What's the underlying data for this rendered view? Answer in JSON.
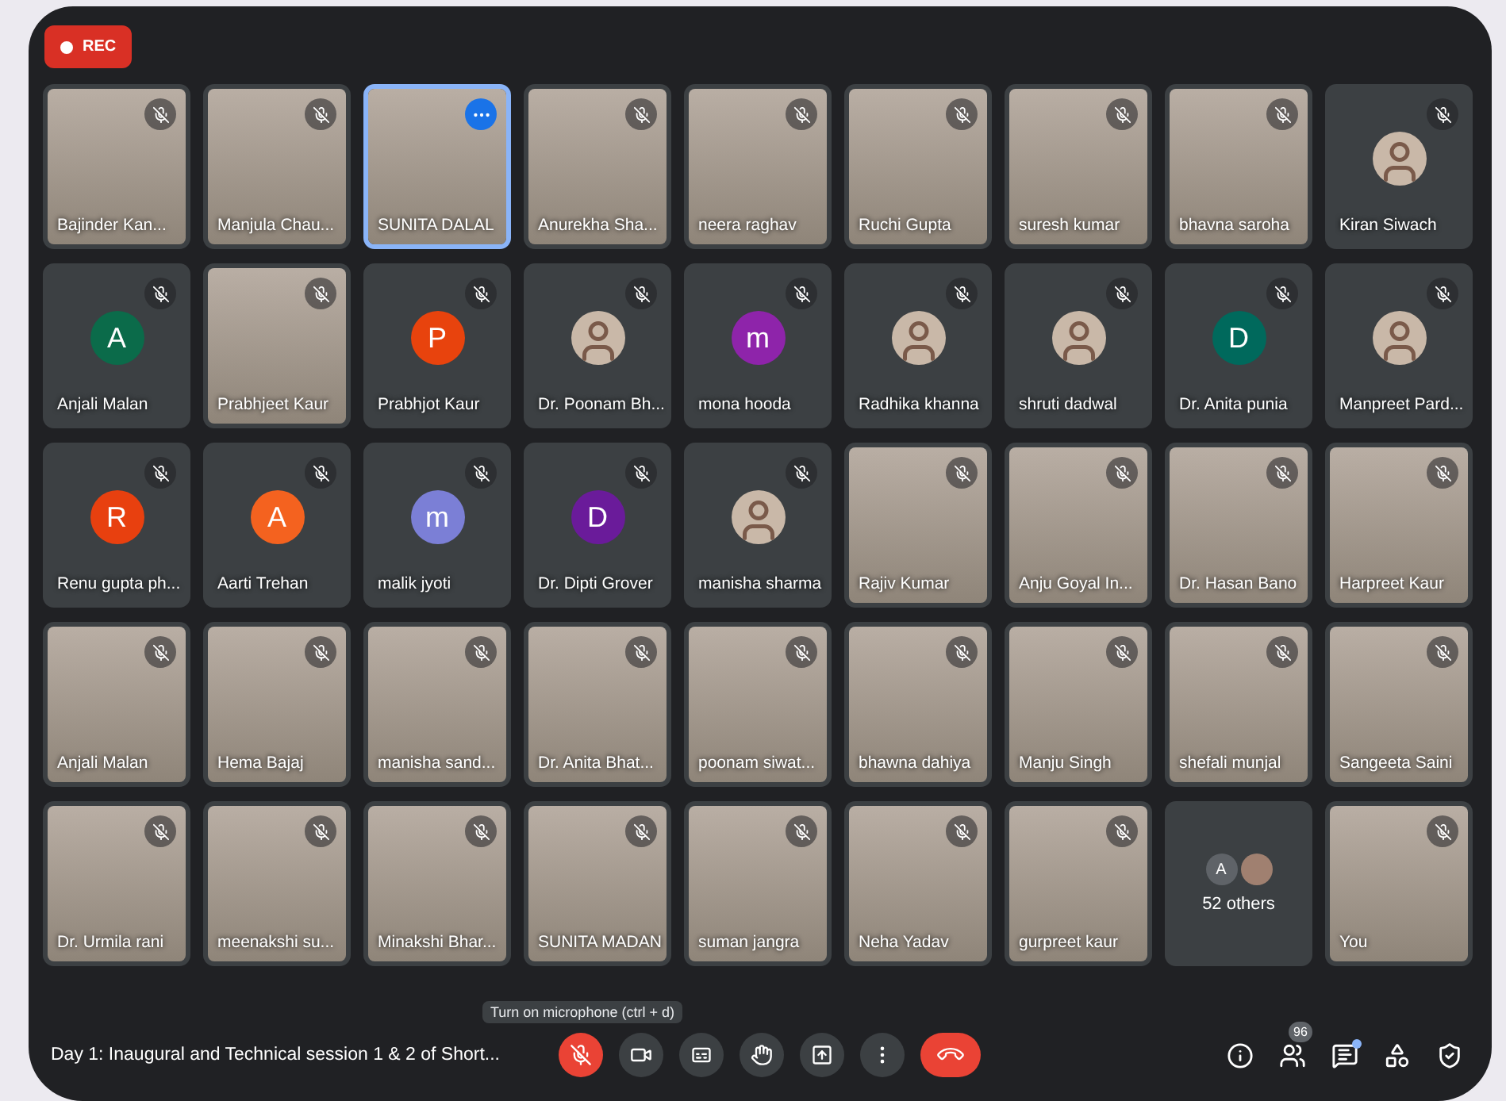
{
  "recording": {
    "label": "REC",
    "active": true
  },
  "tiles": [
    {
      "kind": "video",
      "name": "Bajinder Kan...",
      "muted": true,
      "speaking": false
    },
    {
      "kind": "video",
      "name": "Manjula Chau...",
      "muted": true,
      "speaking": false
    },
    {
      "kind": "video",
      "name": "SUNITA DALAL",
      "muted": false,
      "speaking": true
    },
    {
      "kind": "video",
      "name": "Anurekha Sha...",
      "muted": true,
      "speaking": false
    },
    {
      "kind": "video",
      "name": "neera raghav",
      "muted": true,
      "speaking": false
    },
    {
      "kind": "video",
      "name": "Ruchi Gupta",
      "muted": true,
      "speaking": false
    },
    {
      "kind": "video",
      "name": "suresh kumar",
      "muted": true,
      "speaking": false
    },
    {
      "kind": "video",
      "name": "bhavna saroha",
      "muted": true,
      "speaking": false
    },
    {
      "kind": "photo",
      "name": "Kiran Siwach",
      "muted": true,
      "speaking": false
    },
    {
      "kind": "initial",
      "name": "Anjali Malan",
      "initial": "A",
      "color": "#0b6b4a",
      "muted": true,
      "speaking": false
    },
    {
      "kind": "video",
      "name": "Prabhjeet Kaur",
      "muted": true,
      "speaking": false
    },
    {
      "kind": "initial",
      "name": "Prabhjot Kaur",
      "initial": "P",
      "color": "#e8430d",
      "muted": true,
      "speaking": false
    },
    {
      "kind": "photo",
      "name": "Dr. Poonam Bh...",
      "muted": true,
      "speaking": false
    },
    {
      "kind": "initial",
      "name": "mona hooda",
      "initial": "m",
      "color": "#8e24aa",
      "muted": true,
      "speaking": false
    },
    {
      "kind": "photo",
      "name": "Radhika khanna",
      "muted": true,
      "speaking": false
    },
    {
      "kind": "photo",
      "name": "shruti dadwal",
      "muted": true,
      "speaking": false
    },
    {
      "kind": "initial",
      "name": "Dr. Anita punia",
      "initial": "D",
      "color": "#00695c",
      "muted": true,
      "speaking": false
    },
    {
      "kind": "photo",
      "name": "Manpreet Pard...",
      "muted": true,
      "speaking": false
    },
    {
      "kind": "initial",
      "name": "Renu gupta ph...",
      "initial": "R",
      "color": "#e8400f",
      "muted": true,
      "speaking": false
    },
    {
      "kind": "initial",
      "name": "Aarti Trehan",
      "initial": "A",
      "color": "#f4621f",
      "muted": true,
      "speaking": false
    },
    {
      "kind": "initial",
      "name": "malik jyoti",
      "initial": "m",
      "color": "#7b7fd6",
      "muted": true,
      "speaking": false
    },
    {
      "kind": "initial",
      "name": "Dr. Dipti Grover",
      "initial": "D",
      "color": "#6a1b9a",
      "muted": true,
      "speaking": false
    },
    {
      "kind": "photo",
      "name": "manisha sharma",
      "muted": true,
      "speaking": false
    },
    {
      "kind": "video",
      "name": "Rajiv Kumar",
      "muted": true,
      "speaking": false
    },
    {
      "kind": "video",
      "name": "Anju Goyal In...",
      "muted": true,
      "speaking": false
    },
    {
      "kind": "video",
      "name": "Dr. Hasan Bano",
      "muted": true,
      "speaking": false
    },
    {
      "kind": "video",
      "name": "Harpreet Kaur",
      "muted": true,
      "speaking": false
    },
    {
      "kind": "video",
      "name": "Anjali Malan",
      "muted": true,
      "speaking": false
    },
    {
      "kind": "video",
      "name": "Hema Bajaj",
      "muted": true,
      "speaking": false
    },
    {
      "kind": "video",
      "name": "manisha sand...",
      "muted": true,
      "speaking": false
    },
    {
      "kind": "video",
      "name": "Dr. Anita Bhat...",
      "muted": true,
      "speaking": false
    },
    {
      "kind": "video",
      "name": "poonam siwat...",
      "muted": true,
      "speaking": false
    },
    {
      "kind": "video",
      "name": "bhawna dahiya",
      "muted": true,
      "speaking": false
    },
    {
      "kind": "video",
      "name": "Manju Singh",
      "muted": true,
      "speaking": false
    },
    {
      "kind": "video",
      "name": "shefali munjal",
      "muted": true,
      "speaking": false
    },
    {
      "kind": "video",
      "name": "Sangeeta Saini",
      "muted": true,
      "speaking": false
    },
    {
      "kind": "video",
      "name": "Dr. Urmila rani",
      "muted": true,
      "speaking": false
    },
    {
      "kind": "video",
      "name": "meenakshi su...",
      "muted": true,
      "speaking": false
    },
    {
      "kind": "video",
      "name": "Minakshi Bhar...",
      "muted": true,
      "speaking": false
    },
    {
      "kind": "video",
      "name": "SUNITA MADAN",
      "muted": true,
      "speaking": false
    },
    {
      "kind": "video",
      "name": "suman jangra",
      "muted": true,
      "speaking": false
    },
    {
      "kind": "video",
      "name": "Neha Yadav",
      "muted": true,
      "speaking": false
    },
    {
      "kind": "video",
      "name": "gurpreet kaur",
      "muted": true,
      "speaking": false
    },
    {
      "kind": "others",
      "name": "52 others",
      "initial": "A",
      "color": "#5f6368",
      "muted": false,
      "speaking": false
    },
    {
      "kind": "video",
      "name": "You",
      "muted": true,
      "speaking": false
    }
  ],
  "bottom_bar": {
    "meeting_title": "Day 1: Inaugural and Technical session 1 & 2 of Short...",
    "tooltip": "Turn on microphone (ctrl + d)",
    "mic_on": false,
    "participant_count": "96",
    "chat_unread": true
  }
}
